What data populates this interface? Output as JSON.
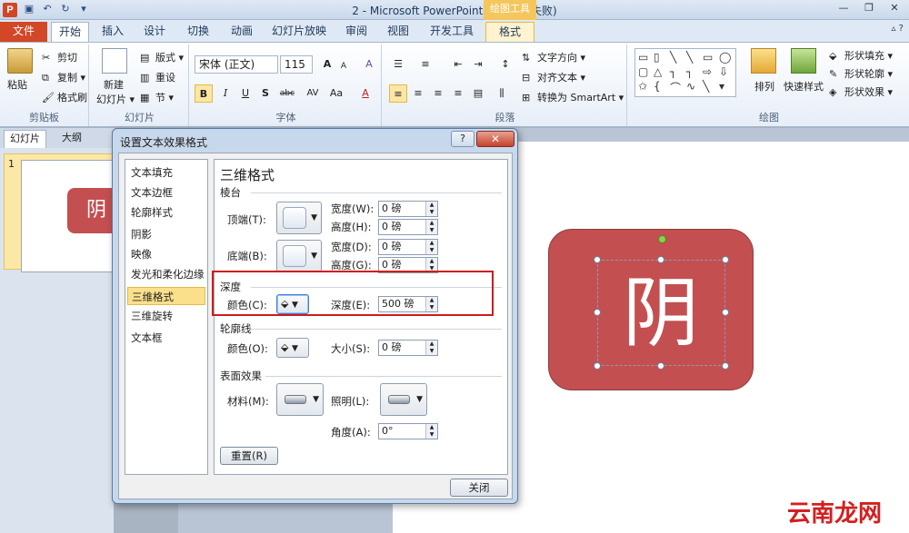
{
  "window": {
    "app_icon": "P",
    "title": "2 - Microsoft PowerPoint(产品激活失败)",
    "context_tab_group": "绘图工具",
    "qat_icons": [
      "save-icon",
      "undo-icon",
      "redo-icon",
      "customize-icon"
    ]
  },
  "tabs": [
    {
      "label": "文件"
    },
    {
      "label": "开始"
    },
    {
      "label": "插入"
    },
    {
      "label": "设计"
    },
    {
      "label": "切换"
    },
    {
      "label": "动画"
    },
    {
      "label": "幻灯片放映"
    },
    {
      "label": "审阅"
    },
    {
      "label": "视图"
    },
    {
      "label": "开发工具"
    },
    {
      "label": "格式"
    }
  ],
  "ribbon": {
    "clipboard": {
      "paste": "粘贴",
      "cut": "剪切",
      "copy": "复制 ▾",
      "format_painter": "格式刷",
      "label": "剪贴板"
    },
    "slides": {
      "new_slide": "新建",
      "new_slide2": "幻灯片 ▾",
      "layout": "版式 ▾",
      "reset": "重设",
      "section": "节 ▾",
      "label": "幻灯片"
    },
    "font": {
      "name": "宋体 (正文)",
      "size": "115",
      "bold": "B",
      "italic": "I",
      "underline": "U",
      "shadow": "S",
      "strike": "abc",
      "spacing": "AV",
      "case": "Aa",
      "color": "A",
      "grow": "A",
      "shrink": "A",
      "clear": "A",
      "label": "字体"
    },
    "paragraph": {
      "text_direction": "文字方向 ▾",
      "align_text": "对齐文本 ▾",
      "smartart": "转换为 SmartArt ▾",
      "label": "段落"
    },
    "drawing": {
      "arrange": "排列",
      "quick_styles": "快速样式",
      "fill": "形状填充 ▾",
      "outline": "形状轮廓 ▾",
      "effects": "形状效果 ▾",
      "label": "绘图"
    }
  },
  "left_pane": {
    "tabs": [
      "幻灯片",
      "大纲"
    ],
    "slide_number": "1",
    "thumb_char": "阴"
  },
  "slide": {
    "shape_text": "阴",
    "shape_color": "#c44f50"
  },
  "dialog": {
    "title": "设置文本效果格式",
    "help": "?",
    "close_x": "✕",
    "nav": [
      "文本填充",
      "文本边框",
      "轮廓样式",
      "阴影",
      "映像",
      "发光和柔化边缘",
      "三维格式",
      "三维旋转",
      "文本框"
    ],
    "selected_nav": "三维格式",
    "section_title": "三维格式",
    "bevel": {
      "heading": "棱台",
      "top_label": "顶端(T):",
      "bottom_label": "底端(B):",
      "width_label": "宽度(W):",
      "height_label": "高度(H):",
      "width2_label": "宽度(D):",
      "height2_label": "高度(G):",
      "top_width": "0 磅",
      "top_height": "0 磅",
      "bottom_width": "0 磅",
      "bottom_height": "0 磅"
    },
    "depth": {
      "heading": "深度",
      "color_label": "颜色(C):",
      "depth_label": "深度(E):",
      "depth_value": "500 磅"
    },
    "contour": {
      "heading": "轮廓线",
      "color_label": "颜色(O):",
      "size_label": "大小(S):",
      "size_value": "0 磅"
    },
    "surface": {
      "heading": "表面效果",
      "material_label": "材料(M):",
      "lighting_label": "照明(L):",
      "angle_label": "角度(A):",
      "angle_value": "0°"
    },
    "reset_button": "重置(R)",
    "close_button": "关闭"
  },
  "watermark": "云南龙网"
}
